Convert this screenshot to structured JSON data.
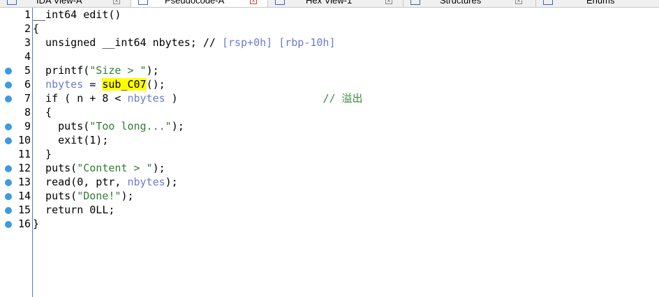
{
  "tabs": [
    {
      "label": "IDA View-A",
      "active": false
    },
    {
      "label": "Pseudocode-A",
      "active": true
    },
    {
      "label": "Hex View-1",
      "active": false
    },
    {
      "label": "Structures",
      "active": false
    },
    {
      "label": "Enums",
      "active": false
    }
  ],
  "lines": [
    {
      "n": "1",
      "bp": false,
      "parts": [
        {
          "t": "__int64 edit()",
          "c": "plain"
        }
      ]
    },
    {
      "n": "2",
      "bp": false,
      "parts": [
        {
          "t": "{",
          "c": "plain"
        }
      ]
    },
    {
      "n": "3",
      "bp": false,
      "parts": [
        {
          "t": "  unsigned __int64 nbytes; // ",
          "c": "plain"
        },
        {
          "t": "[rsp+0h] [rbp-10h]",
          "c": "var"
        }
      ]
    },
    {
      "n": "4",
      "bp": false,
      "parts": []
    },
    {
      "n": "5",
      "bp": true,
      "parts": [
        {
          "t": "  printf(",
          "c": "plain"
        },
        {
          "t": "\"Size > \"",
          "c": "str"
        },
        {
          "t": ");",
          "c": "plain"
        }
      ]
    },
    {
      "n": "6",
      "bp": true,
      "parts": [
        {
          "t": "  ",
          "c": "plain"
        },
        {
          "t": "nbytes",
          "c": "var"
        },
        {
          "t": " = ",
          "c": "plain"
        },
        {
          "t": "sub_C07",
          "c": "hl"
        },
        {
          "t": "();",
          "c": "plain"
        }
      ]
    },
    {
      "n": "7",
      "bp": true,
      "parts": [
        {
          "t": "  if ( n + 8 < ",
          "c": "plain"
        },
        {
          "t": "nbytes",
          "c": "var"
        },
        {
          "t": " )                       ",
          "c": "plain"
        },
        {
          "t": "// 溢出",
          "c": "cmt"
        }
      ]
    },
    {
      "n": "8",
      "bp": false,
      "parts": [
        {
          "t": "  {",
          "c": "plain"
        }
      ]
    },
    {
      "n": "9",
      "bp": true,
      "parts": [
        {
          "t": "    puts(",
          "c": "plain"
        },
        {
          "t": "\"Too long...\"",
          "c": "str"
        },
        {
          "t": ");",
          "c": "plain"
        }
      ]
    },
    {
      "n": "10",
      "bp": true,
      "parts": [
        {
          "t": "    exit(1);",
          "c": "plain"
        }
      ]
    },
    {
      "n": "11",
      "bp": false,
      "parts": [
        {
          "t": "  }",
          "c": "plain"
        }
      ]
    },
    {
      "n": "12",
      "bp": true,
      "parts": [
        {
          "t": "  puts(",
          "c": "plain"
        },
        {
          "t": "\"Content > \"",
          "c": "str"
        },
        {
          "t": ");",
          "c": "plain"
        }
      ]
    },
    {
      "n": "13",
      "bp": true,
      "parts": [
        {
          "t": "  read(0, ptr, ",
          "c": "plain"
        },
        {
          "t": "nbytes",
          "c": "var"
        },
        {
          "t": ");",
          "c": "plain"
        }
      ]
    },
    {
      "n": "14",
      "bp": true,
      "parts": [
        {
          "t": "  puts(",
          "c": "plain"
        },
        {
          "t": "\"Done!\"",
          "c": "str"
        },
        {
          "t": ");",
          "c": "plain"
        }
      ]
    },
    {
      "n": "15",
      "bp": true,
      "parts": [
        {
          "t": "  return 0LL;",
          "c": "plain"
        }
      ]
    },
    {
      "n": "16",
      "bp": true,
      "parts": [
        {
          "t": "}",
          "c": "plain"
        }
      ]
    }
  ]
}
